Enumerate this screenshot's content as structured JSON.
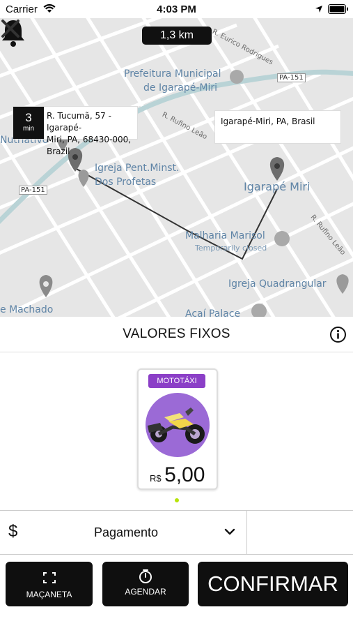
{
  "status_bar": {
    "carrier": "Carrier",
    "time": "4:03 PM"
  },
  "map": {
    "distance": "1,3 km",
    "origin": {
      "eta_value": "3",
      "eta_unit": "min",
      "address_line1": "R. Tucumã, 57 - Igarapé-",
      "address_line2": "Miri, PA, 68430-000, Brazil"
    },
    "destination": {
      "address": "Igarapé-Miri, PA, Brasil"
    },
    "labels": [
      "R. Eurico Rodrigues",
      "Prefeitura Municipal",
      "de Igarapé-Miri",
      "PA-151",
      "R. Rufino Leão",
      "Nutriativo",
      "Igreja Pent.Minst.",
      "Dos Profetas",
      "Igarapé Miri",
      "R. Rufino Leão",
      "Malharia Marisol",
      "Temporarily closed",
      "Igreja Quadrangular",
      "e Machado",
      "Açaí Palace",
      "PA-151"
    ]
  },
  "section": {
    "title": "VALORES FIXOS"
  },
  "service_card": {
    "tag": "MOTOTÁXI",
    "currency": "R$",
    "price": "5,00"
  },
  "payment": {
    "symbol": "$",
    "label": "Pagamento"
  },
  "actions": {
    "macaneta": "MAÇANETA",
    "agendar": "AGENDAR",
    "confirmar": "CONFIRMAR"
  },
  "colors": {
    "accent": "#8b3fc7",
    "dot": "#b7e30a",
    "button": "#0f0f0f"
  },
  "icons": [
    "bell-icon",
    "close-icon",
    "info-icon",
    "dollar-icon",
    "chevron-down-icon",
    "expand-icon",
    "timer-icon"
  ]
}
